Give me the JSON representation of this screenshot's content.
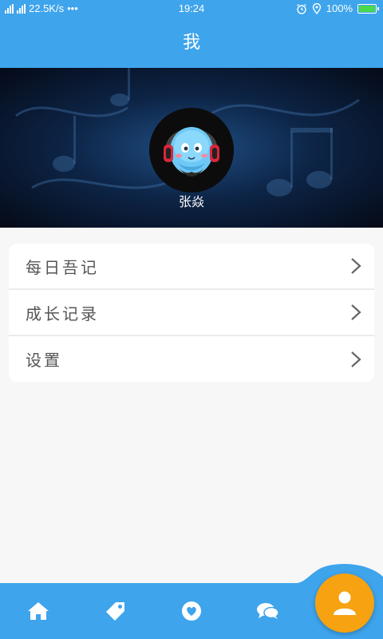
{
  "status_bar": {
    "network_speed": "22.5K/s",
    "more": "•••",
    "time": "19:24",
    "battery_percent": "100%"
  },
  "header": {
    "title": "我"
  },
  "profile": {
    "username": "张焱",
    "avatar_icon": "headphone-face-avatar-icon"
  },
  "menu": {
    "items": [
      {
        "label": "每日吾记",
        "icon": "chevron-right-icon"
      },
      {
        "label": "成长记录",
        "icon": "chevron-right-icon"
      },
      {
        "label": "设置",
        "icon": "chevron-right-icon"
      }
    ]
  },
  "tabbar": {
    "tabs": [
      {
        "icon": "home-icon"
      },
      {
        "icon": "tag-icon"
      },
      {
        "icon": "heart-icon"
      },
      {
        "icon": "chat-bubbles-icon"
      },
      {
        "icon": "user-icon",
        "active": true
      }
    ],
    "colors": {
      "bar": "#3ea4ec",
      "active_fab": "#f6a211"
    }
  },
  "colors": {
    "primary": "#3ea4ec",
    "background": "#f7f7f7"
  }
}
